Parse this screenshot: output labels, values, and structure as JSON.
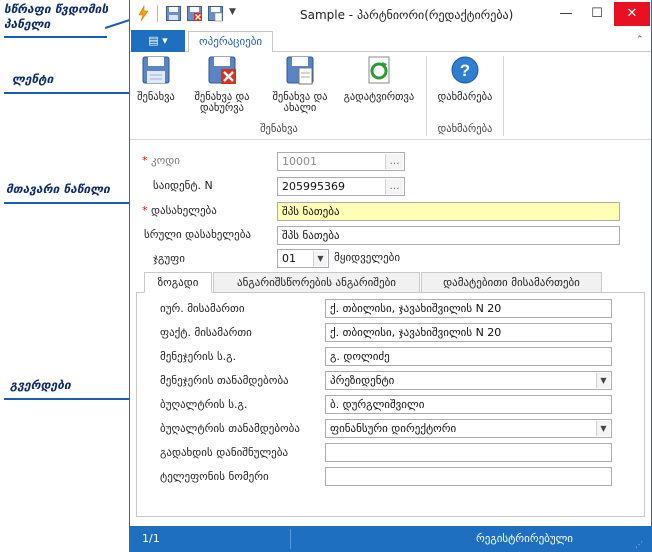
{
  "annotations": {
    "qat_label": [
      "სწრაფი წვდომის",
      "პანელი"
    ],
    "ribbon_label": "ლენტი",
    "main_label": "მთავარი ნაწილი",
    "pages_label": "გვერდები"
  },
  "window": {
    "title": "Sample - პარტნიორი(რედაქტირება)",
    "minimize": "—",
    "maximize": "☐",
    "close": "✕"
  },
  "ribbon": {
    "app_button": "▤ ▾",
    "tab_operations": "ოპერაციები",
    "buttons": {
      "save": "შენახვა",
      "save_close": [
        "შენახვა და",
        "დახურვა"
      ],
      "save_new": [
        "შენახვა და",
        "ახალი"
      ],
      "reload": "გადატვირთვა",
      "help": "დახმარება"
    },
    "groups": {
      "save": "შენახვა",
      "help": "დახმარება"
    }
  },
  "main": {
    "code_label": "კოდი",
    "code_value": "10001",
    "taxid_label": "საიდენტ. N",
    "taxid_value": "205995369",
    "name_label": "დასახელება",
    "name_value": "შპს ნათება",
    "fullname_label": "სრული დასახელება",
    "fullname_value": "შპს ნათება",
    "group_label": "ჯგუფი",
    "group_value": "01",
    "group_desc": "მყიდველები",
    "ellipsis": "…"
  },
  "pages": {
    "tabs": [
      "ზოგადი",
      "ანგარიშსწორების ანგარიშები",
      "დამატებითი მისამართები"
    ],
    "fields": [
      {
        "label": "იურ. მისამართი",
        "value": "ქ. თბილისი, ჯავახიშვილის N 20",
        "kind": "text"
      },
      {
        "label": "ფაქტ. მისამართი",
        "value": "ქ. თბილისი, ჯავახიშვილის N 20",
        "kind": "text"
      },
      {
        "label": "მენეჯერის ს.გ.",
        "value": "გ. დოლიძე",
        "kind": "text"
      },
      {
        "label": "მენეჯერის თანამდებობა",
        "value": "პრეზიდენტი",
        "kind": "select"
      },
      {
        "label": "ბუღალტრის ს.გ.",
        "value": "ბ. დურგლიშვილი",
        "kind": "text"
      },
      {
        "label": "ბუღალტრის თანამდებობა",
        "value": "ფინანსური დირექტორი",
        "kind": "select"
      },
      {
        "label": "გადახდის დანიშნულება",
        "value": "",
        "kind": "text"
      },
      {
        "label": "ტელეფონის ნომერი",
        "value": "",
        "kind": "text"
      }
    ]
  },
  "status": {
    "record": "1/1",
    "state": "რეგისტრირებული"
  },
  "colors": {
    "accent": "#1e6fbf",
    "annotation": "#1b5eb0",
    "required_yellow": "#ffffb5"
  }
}
